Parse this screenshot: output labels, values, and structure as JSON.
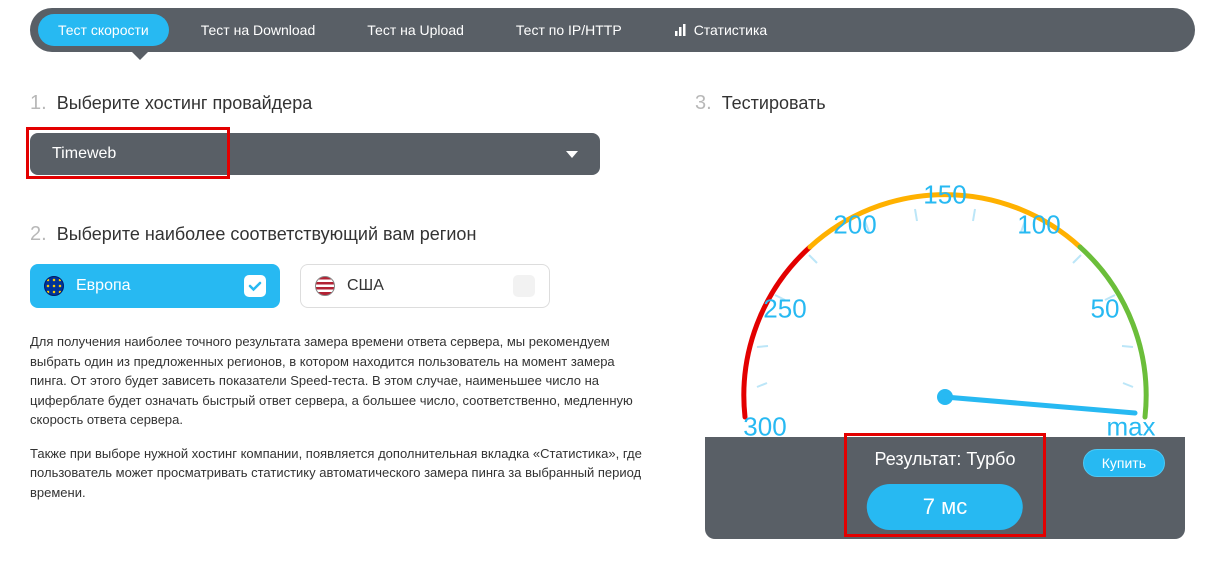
{
  "tabs": [
    {
      "label": "Тест скорости",
      "active": true
    },
    {
      "label": "Тест на Download",
      "active": false
    },
    {
      "label": "Тест на Upload",
      "active": false
    },
    {
      "label": "Тест по IP/HTTP",
      "active": false
    },
    {
      "label": "Статистика",
      "active": false,
      "icon": "stats"
    }
  ],
  "step1": {
    "num": "1.",
    "title": "Выберите хостинг провайдера",
    "selected": "Timeweb"
  },
  "step2": {
    "num": "2.",
    "title": "Выберите наиболее соответствующий вам регион",
    "regions": [
      {
        "label": "Европа",
        "selected": true,
        "flag": "eu"
      },
      {
        "label": "США",
        "selected": false,
        "flag": "us"
      }
    ]
  },
  "description": {
    "p1": "Для получения наиболее точного результата замера времени ответа сервера, мы рекомендуем выбрать один из предложенных регионов, в котором находится пользователь на момент замера пинга. От этого будет зависеть показатели Speed-теста. В этом случае, наименьшее число на циферблате будет означать быстрый ответ сервера, а большее число, соответственно, медленную скорость ответа сервера.",
    "p2": "Также при выборе нужной хостинг компании, появляется дополнительная вкладка «Статистика», где пользователь может просматривать статистику автоматического замера пинга за выбранный период времени."
  },
  "step3": {
    "num": "3.",
    "title": "Тестировать"
  },
  "gauge": {
    "ticks": [
      "300",
      "250",
      "200",
      "150",
      "100",
      "50",
      "max"
    ],
    "needle_value": "7"
  },
  "result": {
    "label": "Результат: Турбо",
    "value": "7 мс",
    "buy": "Купить"
  },
  "colors": {
    "accent": "#27B9F2",
    "bar": "#595F66",
    "highlight": "#E30000"
  }
}
